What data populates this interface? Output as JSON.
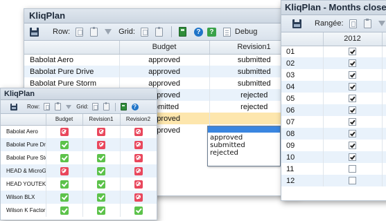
{
  "main_window": {
    "title": "KliqPlan",
    "toolbar": {
      "row_label": "Row:",
      "grid_label": "Grid:",
      "debug_label": "Debug"
    },
    "columns": [
      "Budget",
      "Revision1"
    ],
    "rows": [
      {
        "name": "Babolat Aero",
        "values": [
          "approved",
          "submitted"
        ]
      },
      {
        "name": "Babolat Pure Drive",
        "values": [
          "approved",
          "submitted"
        ]
      },
      {
        "name": "Babolat Pure Storm",
        "values": [
          "approved",
          "submitted"
        ]
      },
      {
        "name": "",
        "values": [
          "approved",
          "rejected"
        ]
      },
      {
        "name": "",
        "values": [
          "ubmitted",
          "rejected"
        ]
      },
      {
        "name": "",
        "values": [
          "approved",
          ""
        ]
      },
      {
        "name": "",
        "values": [
          "approved",
          ""
        ]
      }
    ],
    "dropdown": {
      "options": [
        "approved",
        "submitted",
        "rejected"
      ]
    }
  },
  "months_window": {
    "title": "KliqPlan - Months closed",
    "toolbar": {
      "row_label": "Rangée:"
    },
    "year": "2012",
    "rows": [
      {
        "month": "01",
        "closed": true
      },
      {
        "month": "02",
        "closed": true
      },
      {
        "month": "03",
        "closed": true
      },
      {
        "month": "04",
        "closed": true
      },
      {
        "month": "05",
        "closed": true
      },
      {
        "month": "06",
        "closed": true
      },
      {
        "month": "07",
        "closed": true
      },
      {
        "month": "08",
        "closed": true
      },
      {
        "month": "09",
        "closed": true
      },
      {
        "month": "10",
        "closed": true
      },
      {
        "month": "11",
        "closed": false
      },
      {
        "month": "12",
        "closed": false
      }
    ]
  },
  "status_window": {
    "title": "KliqPlan",
    "toolbar": {
      "row_label": "Row:",
      "grid_label": "Grid:"
    },
    "columns": [
      "Budget",
      "Revision1",
      "Revision2"
    ],
    "rows": [
      {
        "name": "Babolat Aero",
        "status": [
          "no",
          "no",
          "no"
        ]
      },
      {
        "name": "Babolat Pure Driv",
        "status": [
          "ok",
          "no",
          "no"
        ]
      },
      {
        "name": "Babolat Pure Sto",
        "status": [
          "ok",
          "ok",
          "no"
        ]
      },
      {
        "name": "HEAD & MicroGe",
        "status": [
          "no",
          "ok",
          "no"
        ]
      },
      {
        "name": "HEAD YOUTEK",
        "status": [
          "ok",
          "ok",
          "no"
        ]
      },
      {
        "name": "Wilson BLX",
        "status": [
          "ok",
          "ok",
          "no"
        ]
      },
      {
        "name": "Wilson K Factor",
        "status": [
          "ok",
          "ok",
          "ok"
        ]
      }
    ],
    "colors": {
      "approved": "#5cc24a",
      "rejected": "#e9475c"
    }
  }
}
